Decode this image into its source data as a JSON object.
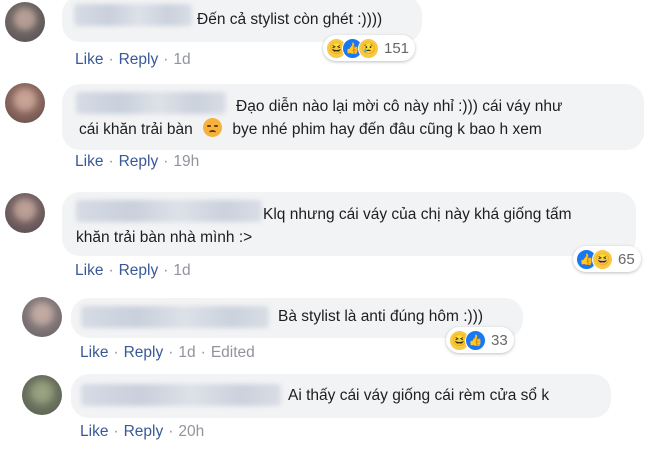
{
  "comments": [
    {
      "text_lines": [
        "Đến cả stylist còn ghét :))))"
      ],
      "actions": {
        "like": "Like",
        "reply": "Reply",
        "time": "1d"
      },
      "reactions": {
        "icons": [
          "haha-icon",
          "like-icon",
          "sad-icon"
        ],
        "count": "151"
      }
    },
    {
      "text_lines": [
        "Đạo diễn nào lại mời cô này nhỉ :))) cái váy như",
        "cái khăn trải bàn",
        "bye nhé phim hay đến đâu cũng k bao h xem"
      ],
      "inline_emoji": "disappointed-face-emoji",
      "actions": {
        "like": "Like",
        "reply": "Reply",
        "time": "19h"
      }
    },
    {
      "text_lines": [
        "Klq nhưng cái váy của chị này khá giống tấm",
        "khăn trải bàn nhà mình :>"
      ],
      "actions": {
        "like": "Like",
        "reply": "Reply",
        "time": "1d"
      },
      "reactions": {
        "icons": [
          "like-icon",
          "haha-icon"
        ],
        "count": "65"
      }
    },
    {
      "text_lines": [
        "Bà stylist là anti đúng hôm :)))"
      ],
      "actions": {
        "like": "Like",
        "reply": "Reply",
        "time": "1d",
        "edited": "Edited"
      },
      "reactions": {
        "icons": [
          "haha-icon",
          "like-icon"
        ],
        "count": "33"
      }
    },
    {
      "text_lines": [
        "Ai thấy cái váy giống cái rèm cửa sổ k"
      ],
      "actions": {
        "like": "Like",
        "reply": "Reply",
        "time": "20h"
      }
    }
  ],
  "colors": {
    "link": "#385898",
    "bubble": "#f2f3f5",
    "meta": "#90949c",
    "like_blue": "#1877f2",
    "emoji_yellow": "#f7c844"
  }
}
